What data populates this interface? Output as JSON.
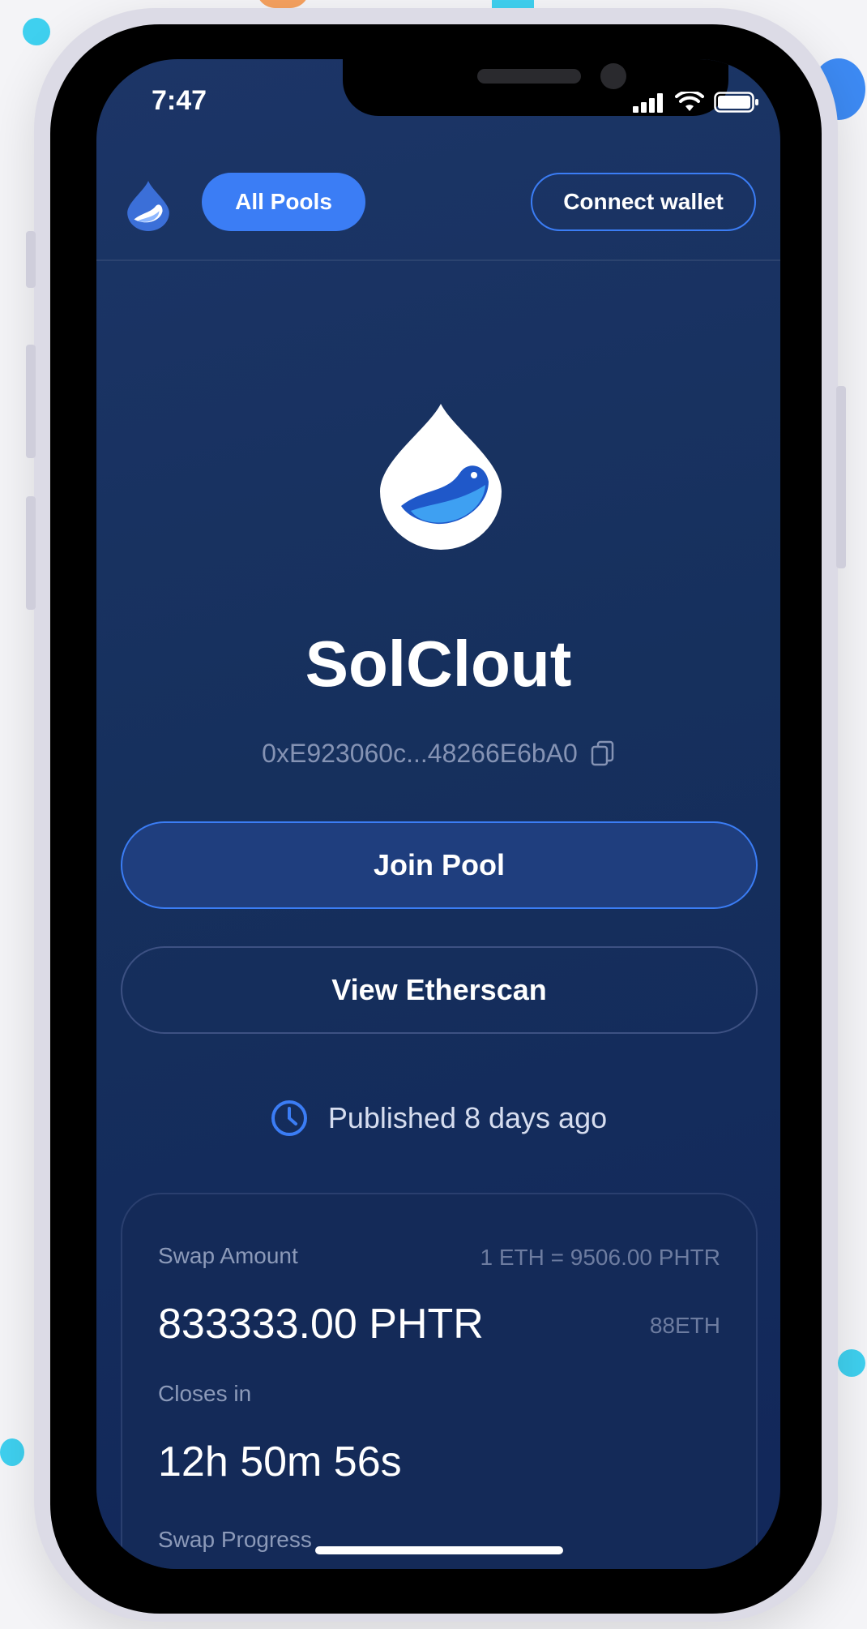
{
  "status_bar": {
    "time": "7:47"
  },
  "header": {
    "all_pools_label": "All Pools",
    "connect_wallet_label": "Connect wallet"
  },
  "pool": {
    "name": "SolClout",
    "address": "0xE923060c...48266E6bA0",
    "join_label": "Join Pool",
    "etherscan_label": "View Etherscan",
    "published": "Published 8 days ago"
  },
  "card": {
    "swap_amount_label": "Swap Amount",
    "rate": "1 ETH = 9506.00 PHTR",
    "swap_amount": "833333.00 PHTR",
    "eth_amount": "88ETH",
    "closes_label": "Closes in",
    "closes_value": "12h 50m 56s",
    "progress_label": "Swap Progress"
  },
  "colors": {
    "accent": "#3b7df5",
    "background": "#16305d",
    "card": "#142a58"
  }
}
